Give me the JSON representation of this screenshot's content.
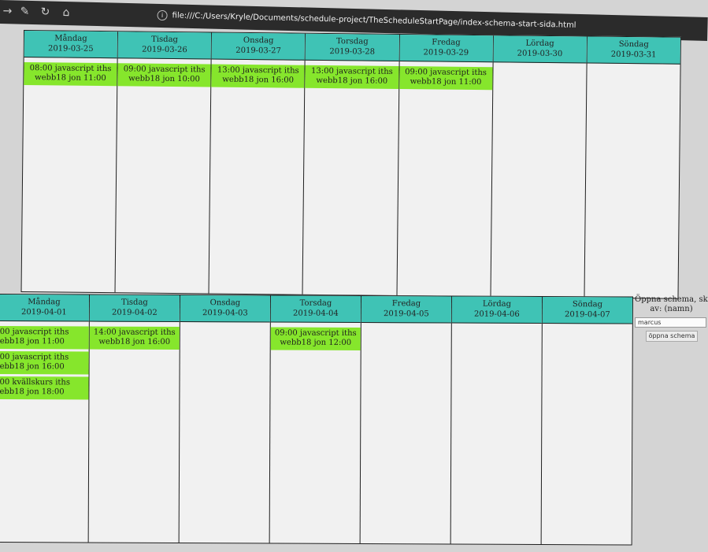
{
  "browser": {
    "url": "file:///C:/Users/Kryle/Documents/schedule-project/TheScheduleStartPage/index-schema-start-sida.html",
    "icons": [
      "forward-icon",
      "wrench-icon",
      "reload-icon",
      "home-icon",
      "info-icon"
    ]
  },
  "week1": {
    "days": [
      {
        "name": "Måndag",
        "date": "2019-03-25",
        "events": [
          {
            "line1": "08:00 javascript iths",
            "line2": "webb18 jon 11:00"
          }
        ]
      },
      {
        "name": "Tisdag",
        "date": "2019-03-26",
        "events": [
          {
            "line1": "09:00 javascript iths",
            "line2": "webb18 jon 10:00"
          }
        ]
      },
      {
        "name": "Onsdag",
        "date": "2019-03-27",
        "events": [
          {
            "line1": "13:00 javascript iths",
            "line2": "webb18 jon 16:00"
          }
        ]
      },
      {
        "name": "Torsdag",
        "date": "2019-03-28",
        "events": [
          {
            "line1": "13:00 javascript iths",
            "line2": "webb18 jon 16:00"
          }
        ]
      },
      {
        "name": "Fredag",
        "date": "2019-03-29",
        "events": [
          {
            "line1": "09:00 javascript iths",
            "line2": "webb18 jon 11:00"
          }
        ]
      },
      {
        "name": "Lördag",
        "date": "2019-03-30",
        "events": []
      },
      {
        "name": "Söndag",
        "date": "2019-03-31",
        "events": []
      }
    ]
  },
  "week2": {
    "days": [
      {
        "name": "Måndag",
        "date": "2019-04-01",
        "events": [
          {
            "line1": "00 javascript iths",
            "line2": "ebb18 jon 11:00"
          },
          {
            "line1": "00 javascript iths",
            "line2": "ebb18 jon 16:00"
          },
          {
            "line1": "00 kvällskurs iths",
            "line2": "ebb18 jon 18:00"
          }
        ]
      },
      {
        "name": "Tisdag",
        "date": "2019-04-02",
        "events": [
          {
            "line1": "14:00 javascript iths",
            "line2": "webb18 jon 16:00"
          }
        ]
      },
      {
        "name": "Onsdag",
        "date": "2019-04-03",
        "events": []
      },
      {
        "name": "Torsdag",
        "date": "2019-04-04",
        "events": [
          {
            "line1": "09:00 javascript iths",
            "line2": "webb18 jon 12:00"
          }
        ]
      },
      {
        "name": "Fredag",
        "date": "2019-04-05",
        "events": []
      },
      {
        "name": "Lördag",
        "date": "2019-04-06",
        "events": []
      },
      {
        "name": "Söndag",
        "date": "2019-04-07",
        "events": []
      }
    ]
  },
  "side_panel": {
    "title_line1": "Öppna schema, skap",
    "title_line2": "av: (namn)",
    "input_value": "marcus",
    "button_label": "öppna schema"
  },
  "colors": {
    "header": "#3fc3b5",
    "event": "#86e62c",
    "browser_bar": "#2b2b2b"
  }
}
